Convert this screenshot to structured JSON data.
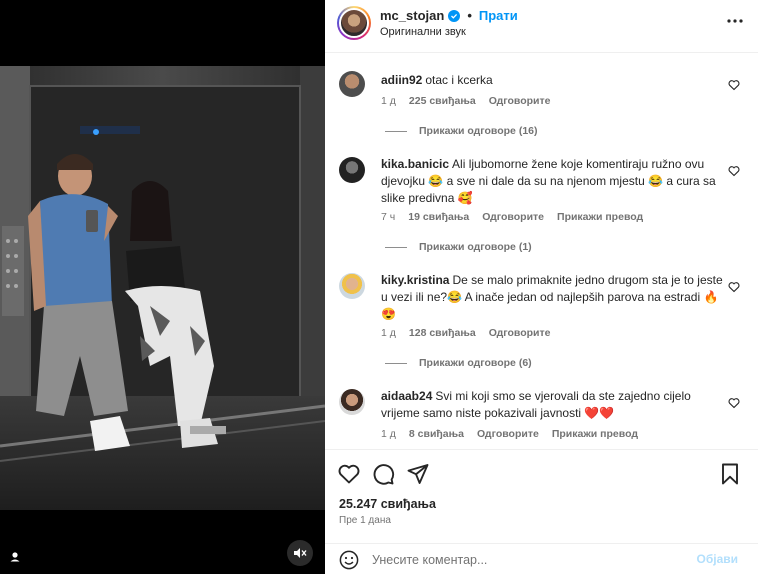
{
  "header": {
    "username": "mc_stojan",
    "separator": "•",
    "follow_label": "Прати",
    "audio_label": "Оригинални звук"
  },
  "comments": [
    {
      "username": "adiin92",
      "text": "otac i kcerka",
      "time": "1 д",
      "likes": "225 свиђања",
      "reply_label": "Одговорите",
      "translate_label": "",
      "view_replies": "Прикажи одговоре (16)"
    },
    {
      "username": "kika.banicic",
      "text": "Ali ljubomorne žene koje komentiraju ružno ovu djevojku 😂 a sve ni dale da su na njenom mjestu 😂 a cura sa slike predivna 🥰",
      "time": "7 ч",
      "likes": "19 свиђања",
      "reply_label": "Одговорите",
      "translate_label": "Прикажи превод",
      "view_replies": "Прикажи одговоре (1)"
    },
    {
      "username": "kiky.kristina",
      "text": "De se malo primaknite jedno drugom sta je to jeste u vezi ili ne?😂 A inače jedan od najlepših parova na estradi 🔥😍",
      "time": "1 д",
      "likes": "128 свиђања",
      "reply_label": "Одговорите",
      "translate_label": "",
      "view_replies": "Прикажи одговоре (6)"
    },
    {
      "username": "aidaab24",
      "text": "Svi mi koji smo se vjerovali da ste zajedno cijelo vrijeme samo niste pokazivali javnosti ❤️❤️",
      "time": "1 д",
      "likes": "8 свиђања",
      "reply_label": "Одговорите",
      "translate_label": "Прикажи превод",
      "view_replies": ""
    }
  ],
  "post": {
    "likes": "25.247 свиђања",
    "time": "Пре 1 дана"
  },
  "composer": {
    "placeholder": "Унесите коментар...",
    "post_label": "Објави"
  },
  "colors": {
    "accent": "#0095f6",
    "text": "#262626",
    "muted": "#737373",
    "post_disabled": "#b2dffc"
  },
  "icons": [
    "user-tag-icon",
    "mute-icon",
    "verified-icon",
    "more-icon",
    "heart-icon",
    "comment-icon",
    "share-icon",
    "bookmark-icon",
    "emoji-icon"
  ]
}
